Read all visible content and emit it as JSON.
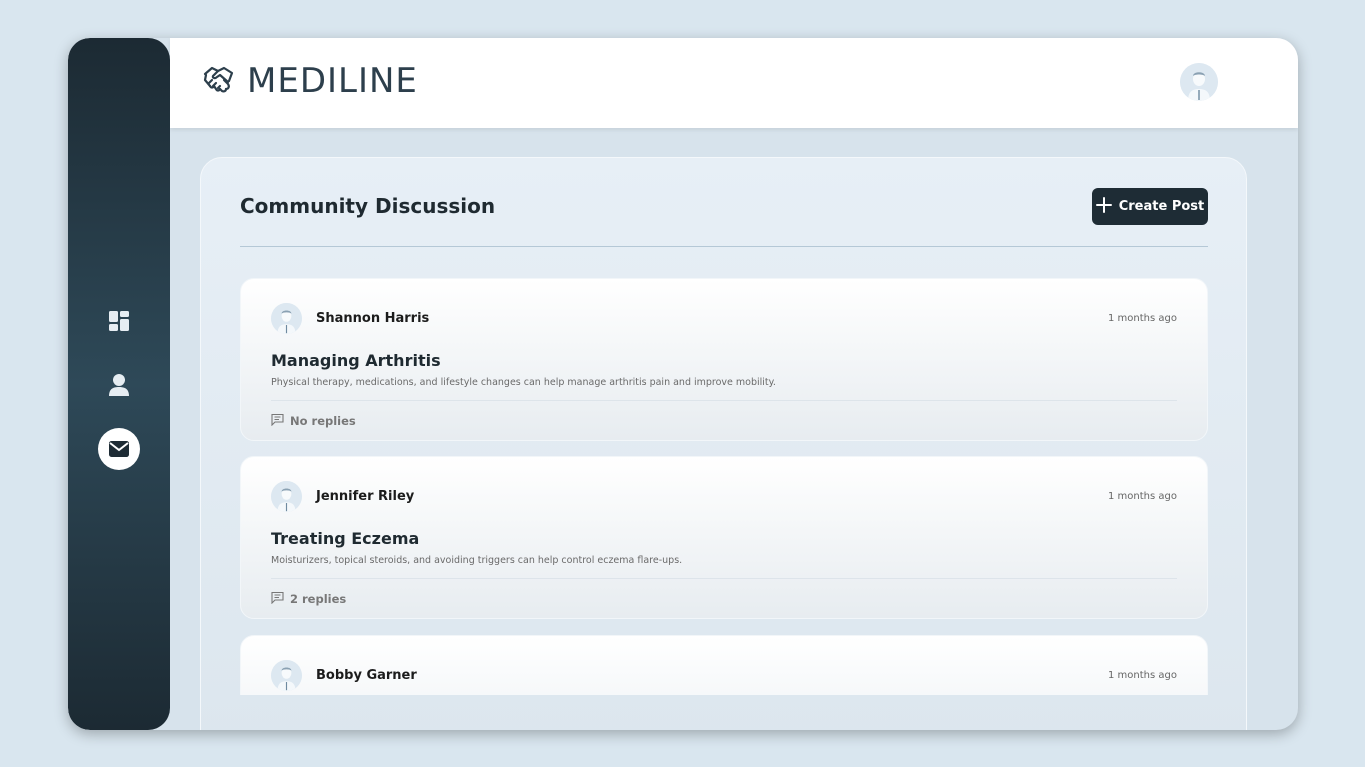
{
  "brand": {
    "name": "MEDILINE",
    "logo_icon": "handshake-icon"
  },
  "sidebar": {
    "items": [
      {
        "icon": "dashboard-icon",
        "active": false
      },
      {
        "icon": "user-icon",
        "active": false
      },
      {
        "icon": "mail-icon",
        "active": true
      }
    ]
  },
  "header": {
    "avatar_icon": "user-avatar-icon"
  },
  "main": {
    "title": "Community Discussion",
    "create_button_label": "Create Post",
    "create_button_icon": "plus-icon",
    "posts": [
      {
        "author": "Shannon Harris",
        "time": "1 months ago",
        "title": "Managing Arthritis",
        "body": "Physical therapy, medications, and lifestyle changes can help manage arthritis pain and improve mobility.",
        "replies": "No replies"
      },
      {
        "author": "Jennifer Riley",
        "time": "1 months ago",
        "title": "Treating Eczema",
        "body": "Moisturizers, topical steroids, and avoiding triggers can help control eczema flare-ups.",
        "replies": "2 replies"
      },
      {
        "author": "Bobby Garner",
        "time": "1 months ago",
        "title": "",
        "body": "",
        "replies": ""
      }
    ]
  },
  "colors": {
    "page_bg": "#d9e6ef",
    "sidebar_dark": "#1c2a33",
    "sidebar_mid": "#2e4958",
    "accent_dark": "#1e2c35",
    "brand_text": "#2d3f4c"
  }
}
